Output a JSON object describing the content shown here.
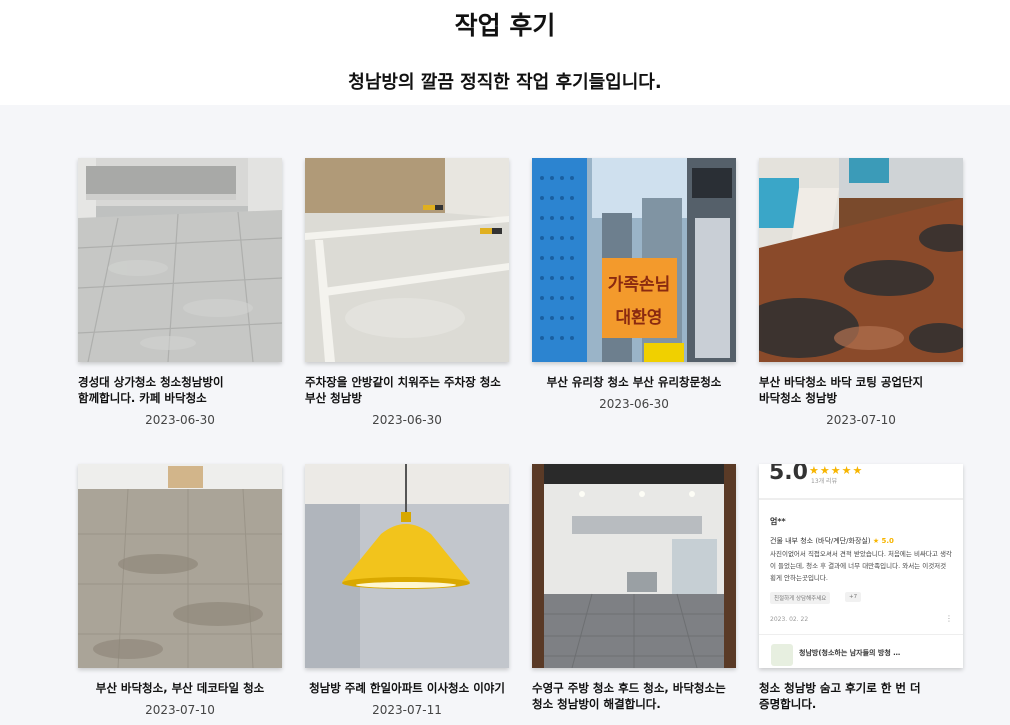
{
  "page": {
    "title": "작업 후기",
    "subtitle": "청남방의 깔끔 정직한 작업 후기들입니다."
  },
  "cards": [
    {
      "caption": "경성대 상가청소 청소청남방이 함께합니다. 카페 바닥청소",
      "date": "2023-06-30",
      "image": "marble-floor-photo"
    },
    {
      "caption": "주차장을 안방같이 치워주는 주차장 청소 부산 청남방",
      "date": "2023-06-30",
      "image": "parking-lot-photo"
    },
    {
      "caption": "부산 유리창 청소 부산 유리창문청소",
      "date": "2023-06-30",
      "image": "shop-window-photo",
      "sign_text": [
        "가족손님",
        "대환영"
      ]
    },
    {
      "caption": "부산 바닥청소 바닥 코팅 공업단지 바닥청소 청남방",
      "date": "2023-07-10",
      "image": "coated-floor-photo"
    },
    {
      "caption": "부산 바닥청소, 부산 데코타일 청소",
      "date": "2023-07-10",
      "image": "deco-tile-floor-photo"
    },
    {
      "caption": "청남방 주례 한일아파트 이사청소 이야기",
      "date": "2023-07-11",
      "image": "yellow-pendant-lamp-photo"
    },
    {
      "caption": "수영구 주방 청소 후드 청소, 바닥청소는 청소 청남방이 해결합니다.",
      "date": "",
      "image": "kitchen-photo"
    },
    {
      "caption": "청소 청남방 숨고 후기로 한 번 더 증명합니다.",
      "date": "",
      "image": "review-screenshot"
    }
  ],
  "review": {
    "score": "5.0",
    "stars": "★★★★★",
    "count": "13개 리뷰",
    "user": "엄**",
    "service": "건물 내부 청소 (바닥/계단/화장실)",
    "service_score": "★ 5.0",
    "body": "사진이없어서 직접오셔서 견적 받았습니다. 처음에는 비싸다고 생각이 들었는데, 청소 후 결과에 너무 대만족입니다. 와서는 이것저것 횡게 안하는곳입니다.",
    "tags": [
      "친절하게 상담해주세요",
      "+7"
    ],
    "date": "2023. 02. 22",
    "more": "⋮",
    "business": "청남방(청소하는 남자들의 방청 …"
  },
  "colors": {
    "background": "#f5f6f9",
    "star": "#f7b500"
  }
}
